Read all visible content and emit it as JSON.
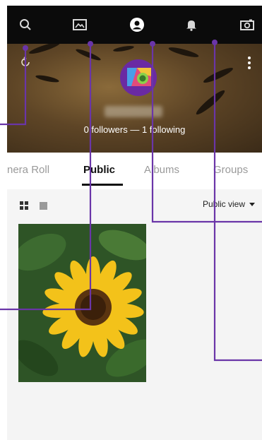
{
  "header": {
    "icons": [
      "search-icon",
      "gallery-icon",
      "profile-icon",
      "bell-icon",
      "camera-icon"
    ]
  },
  "profile": {
    "counts_text": "0 followers — 1 following"
  },
  "tabs": [
    {
      "label": "nera Roll"
    },
    {
      "label": "Public"
    },
    {
      "label": "Albums"
    },
    {
      "label": "Groups"
    }
  ],
  "view": {
    "select_label": "Public view"
  },
  "colors": {
    "accent": "#6a2aa3",
    "topbar": "#0b0b0b",
    "callout": "#6a35a8"
  }
}
